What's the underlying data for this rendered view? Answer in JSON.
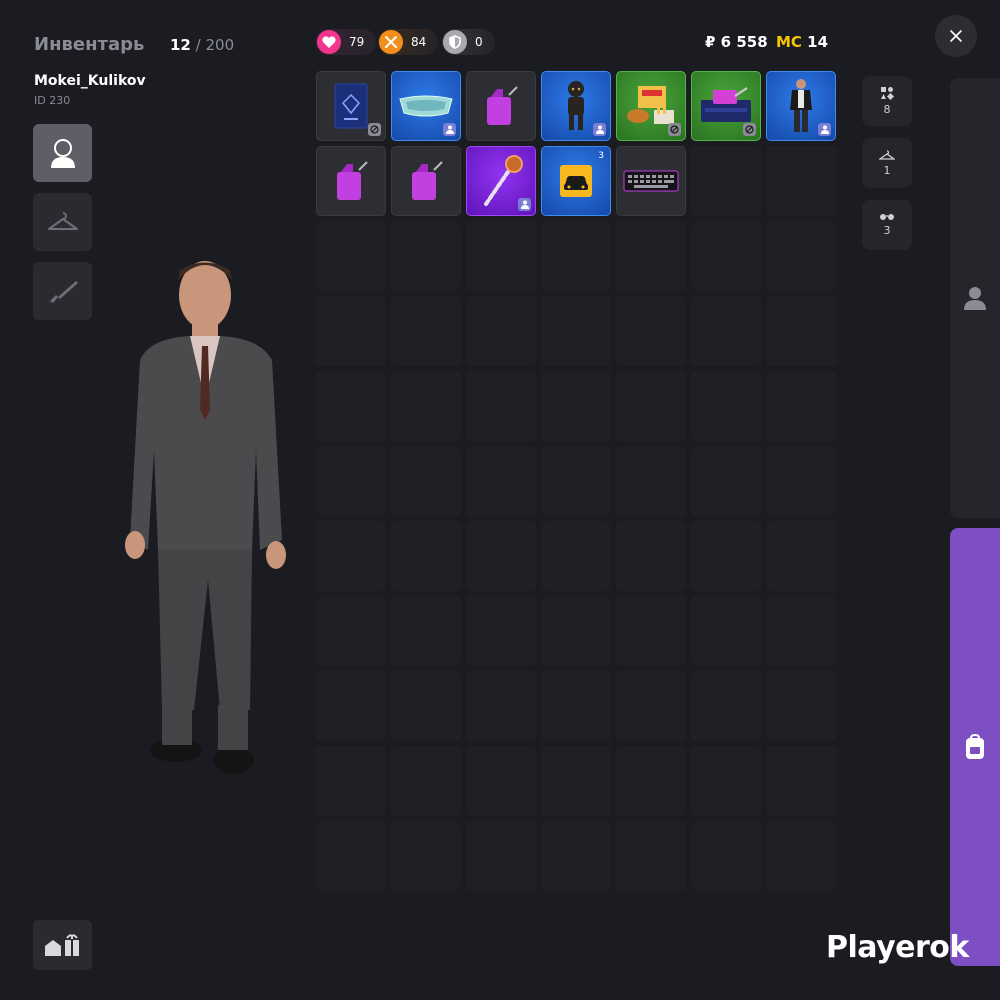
{
  "header": {
    "title": "Инвентарь",
    "slots_used": "12",
    "slots_total": "/ 200"
  },
  "player": {
    "name": "Mokei_Kulikov",
    "id": "ID 230"
  },
  "stats": {
    "health": "79",
    "food": "84",
    "armor": "0"
  },
  "currency": {
    "money": "₽ 6 558",
    "mc_label": "MC",
    "mc_value": "14"
  },
  "categories": [
    {
      "name": "all",
      "count": "8"
    },
    {
      "name": "clothes",
      "count": "1"
    },
    {
      "name": "accessories",
      "count": "3"
    }
  ],
  "inventory": [
    {
      "item": "passport",
      "rarity": "common",
      "badge": "blocked"
    },
    {
      "item": "cyber-glasses",
      "rarity": "blue",
      "badge": "person"
    },
    {
      "item": "fuel-canister",
      "rarity": "common",
      "badge": ""
    },
    {
      "item": "dark-figure-costume",
      "rarity": "blue",
      "badge": "person"
    },
    {
      "item": "food-set",
      "rarity": "green",
      "badge": "blocked"
    },
    {
      "item": "toolbox",
      "rarity": "green",
      "badge": "blocked"
    },
    {
      "item": "outfit",
      "rarity": "blue",
      "badge": "person"
    },
    {
      "item": "fuel-canister",
      "rarity": "common",
      "badge": ""
    },
    {
      "item": "fuel-canister",
      "rarity": "common",
      "badge": ""
    },
    {
      "item": "staff",
      "rarity": "purple",
      "badge": "person"
    },
    {
      "item": "car-certificate",
      "rarity": "blue",
      "badge": "",
      "qty": "3"
    },
    {
      "item": "keyboard",
      "rarity": "common",
      "badge": ""
    }
  ],
  "watermark": "Playerok",
  "colors": {
    "background": "#1b1c21",
    "accent_purple": "#7d4fc2",
    "health": "#f0368f",
    "food": "#f28e1c",
    "mc": "#f7c600"
  }
}
